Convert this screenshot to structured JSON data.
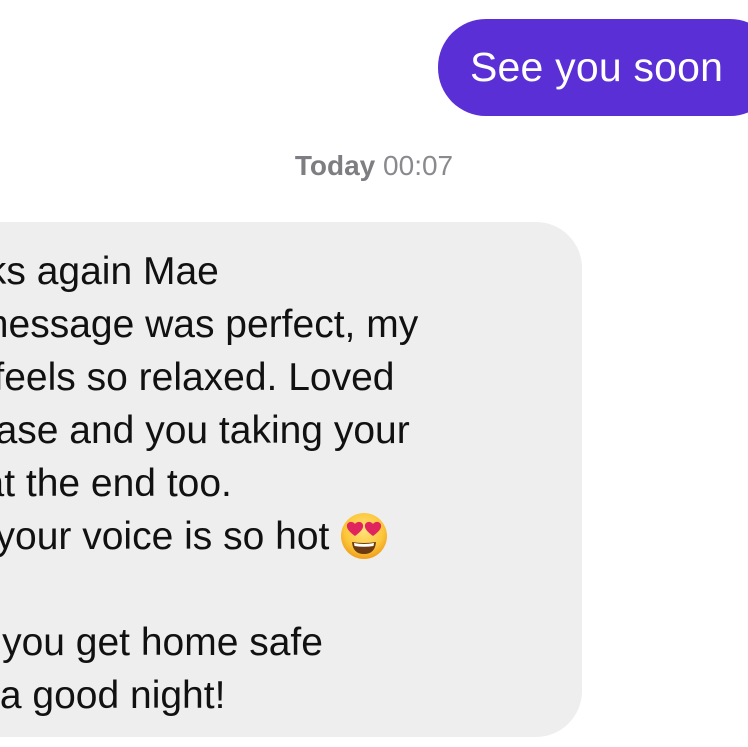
{
  "conversation": {
    "outgoing_message": "See you soon",
    "timestamp": {
      "day": "Today",
      "time": "00:07"
    },
    "incoming_message": {
      "lines": [
        "Thanks again Mae",
        "The message was perfect, my",
        "body feels so relaxed. Loved",
        "the tease and you taking your",
        "time at the end too.",
        "Also, your voice is so hot",
        "",
        "Hope you get home safe",
        "Have a good night!"
      ],
      "emoji": "heart-eyes-emoji"
    }
  },
  "colors": {
    "outgoing_bubble": "#5b2fd6",
    "incoming_bubble": "#eeeeef",
    "timestamp_text": "#8a8a8e"
  }
}
